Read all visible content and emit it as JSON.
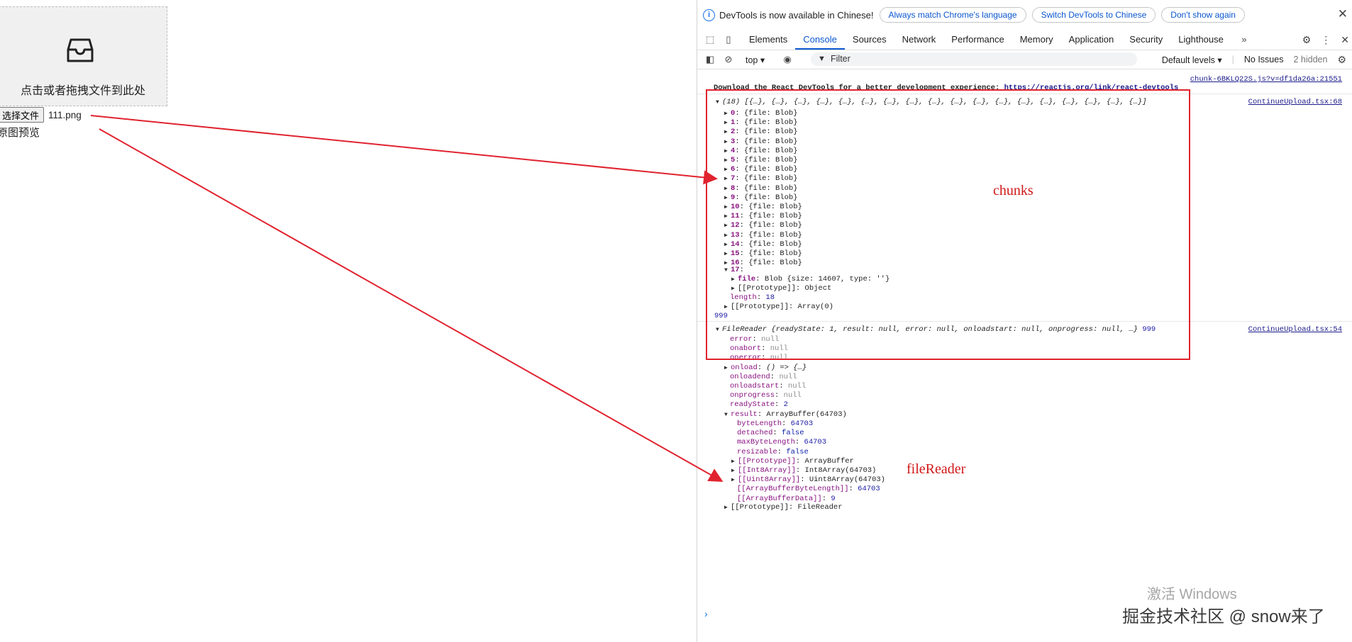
{
  "left": {
    "upload_text": "点击或者拖拽文件到此处",
    "file_button": "选择文件",
    "file_name": "111.png",
    "preview_label": "原图预览"
  },
  "devtools": {
    "infobar": {
      "message": "DevTools is now available in Chinese!",
      "btn_match": "Always match Chrome's language",
      "btn_switch": "Switch DevTools to Chinese",
      "btn_dont": "Don't show again"
    },
    "tabs": [
      "Elements",
      "Console",
      "Sources",
      "Network",
      "Performance",
      "Memory",
      "Application",
      "Security",
      "Lighthouse"
    ],
    "console_toolbar": {
      "context": "top",
      "filter_placeholder": "Filter",
      "levels": "Default levels",
      "issues": "No Issues",
      "hidden": "2 hidden"
    },
    "console": {
      "source_link_top": "chunk-6BKLQ22S.js?v=df1da26a:21551",
      "react_msg": "Download the React DevTools for a better development experience: ",
      "react_link": "https://reactjs.org/link/react-devtools",
      "array_head": "(18) [{…}, {…}, {…}, {…}, {…}, {…}, {…}, {…}, {…}, {…}, {…}, {…}, {…}, {…}, {…}, {…}, {…}, {…}]",
      "array_source": "ContinueUpload.tsx:68",
      "blob_entry": "{file: Blob}",
      "entry17_key": "17",
      "file_key": "file",
      "file_value": "Blob {size: 14607, type: ''}",
      "proto_object": "[[Prototype]]: Object",
      "length_key": "length",
      "length_value": "18",
      "proto_array": "[[Prototype]]: Array(0)",
      "log_999": "999",
      "filereader_head": "FileReader {readyState: 1, result: null, error: null, onloadstart: null, onprogress: null, …}",
      "filereader_suffix": "999",
      "filereader_source": "ContinueUpload.tsx:54",
      "fr_props": [
        {
          "k": "error",
          "v": "null"
        },
        {
          "k": "onabort",
          "v": "null"
        },
        {
          "k": "onerror",
          "v": "null"
        },
        {
          "k": "onload",
          "v": "() => {…}"
        },
        {
          "k": "onloadend",
          "v": "null"
        },
        {
          "k": "onloadstart",
          "v": "null"
        },
        {
          "k": "onprogress",
          "v": "null"
        },
        {
          "k": "readyState",
          "v": "2"
        },
        {
          "k": "result",
          "v": "ArrayBuffer(64703)"
        }
      ],
      "ab_props": [
        {
          "k": "byteLength",
          "v": "64703"
        },
        {
          "k": "detached",
          "v": "false"
        },
        {
          "k": "maxByteLength",
          "v": "64703"
        },
        {
          "k": "resizable",
          "v": "false"
        },
        {
          "k": "[[Prototype]]",
          "v": "ArrayBuffer"
        },
        {
          "k": "[[Int8Array]]",
          "v": "Int8Array(64703)"
        },
        {
          "k": "[[Uint8Array]]",
          "v": "Uint8Array(64703)"
        },
        {
          "k": "[[ArrayBufferByteLength]]",
          "v": "64703"
        },
        {
          "k": "[[ArrayBufferData]]",
          "v": "9"
        }
      ],
      "fr_proto": "[[Prototype]]: FileReader"
    }
  },
  "annotations": {
    "chunks": "chunks",
    "filereader": "fileReader"
  },
  "watermarks": {
    "windows": "激活 Windows",
    "site": "掘金技术社区 @ snow来了"
  },
  "colors": {
    "accent": "#0b57d0",
    "annotation_red": "#e0232f"
  }
}
